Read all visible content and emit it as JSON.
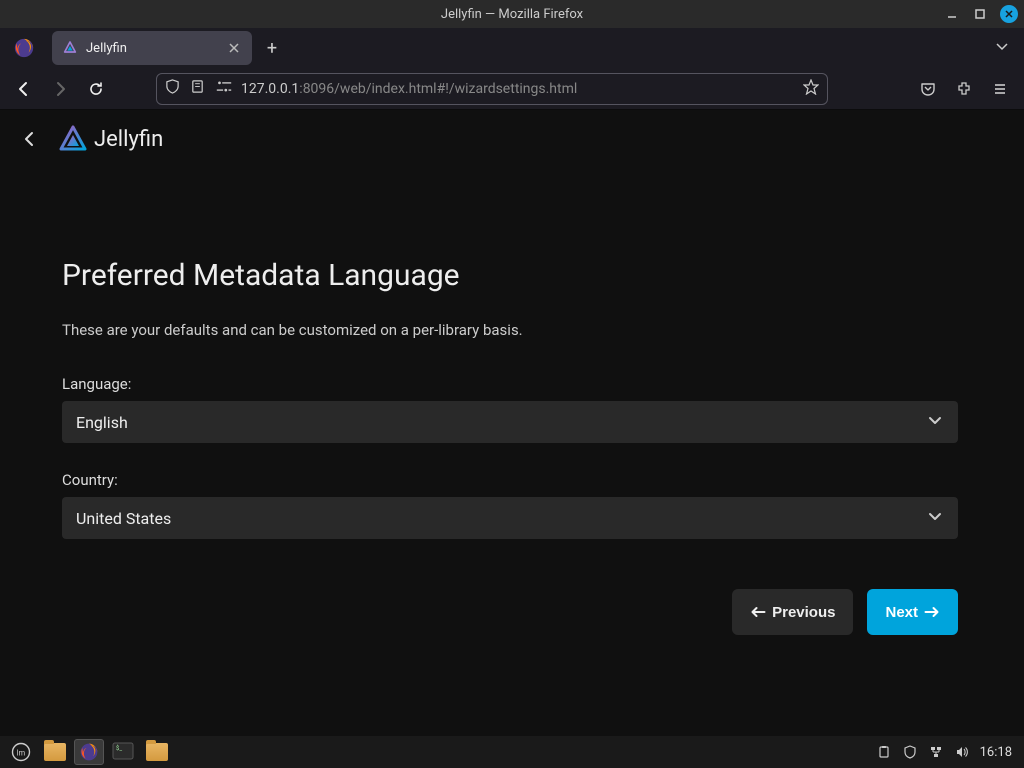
{
  "window": {
    "title": "Jellyfin — Mozilla Firefox"
  },
  "tab": {
    "title": "Jellyfin"
  },
  "url": {
    "host": "127.0.0.1",
    "rest": ":8096/web/index.html#!/wizardsettings.html"
  },
  "jellyfin": {
    "brand": "Jellyfin",
    "page_title": "Preferred Metadata Language",
    "subtitle": "These are your defaults and can be customized on a per-library basis.",
    "fields": {
      "language_label": "Language:",
      "language_value": "English",
      "country_label": "Country:",
      "country_value": "United States"
    },
    "buttons": {
      "previous": "Previous",
      "next": "Next"
    }
  },
  "taskbar": {
    "clock": "16:18"
  }
}
